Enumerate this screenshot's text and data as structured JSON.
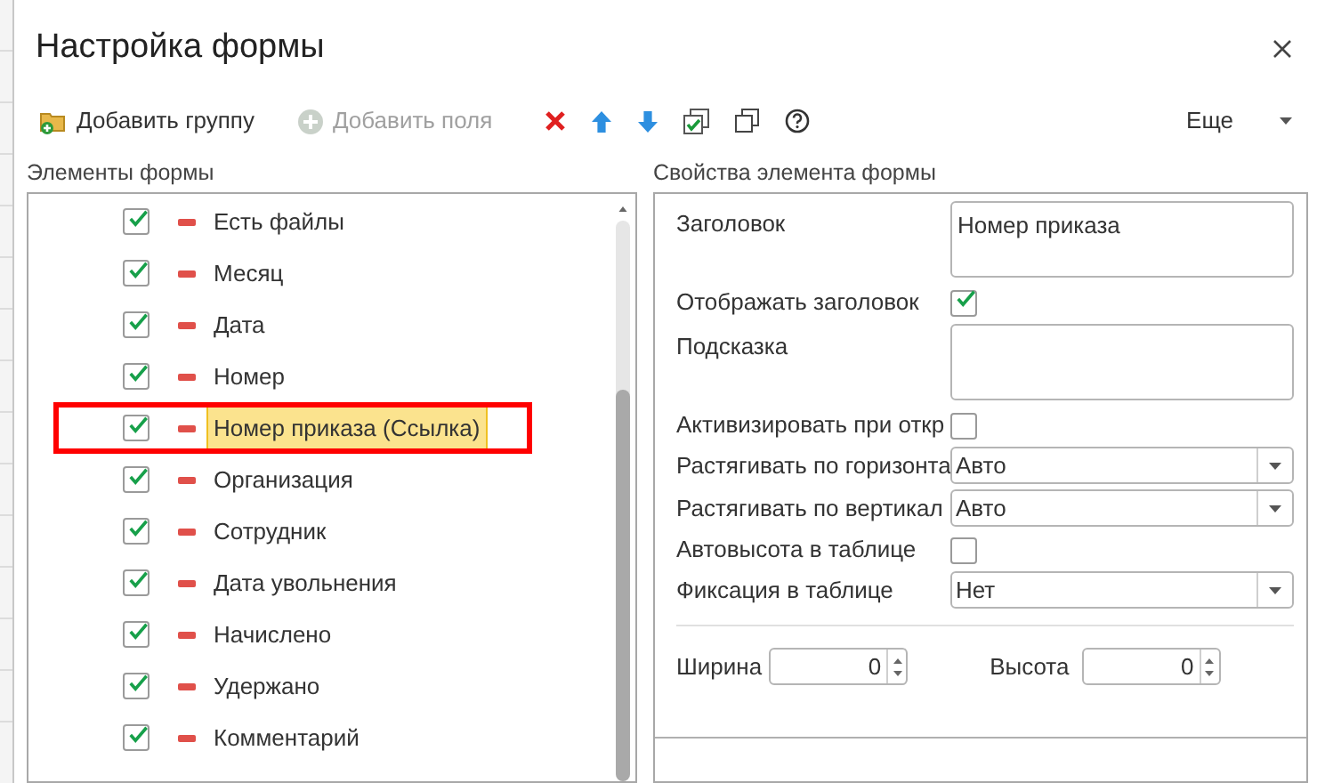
{
  "window": {
    "title": "Настройка формы"
  },
  "toolbar": [
    {
      "kind": "add-group",
      "label": "Добавить группу",
      "disabled": false
    },
    {
      "kind": "add-field",
      "label": "Добавить поля",
      "disabled": true
    },
    {
      "kind": "delete",
      "disabled": false
    },
    {
      "kind": "up",
      "disabled": false
    },
    {
      "kind": "down",
      "disabled": false
    },
    {
      "kind": "check-all",
      "disabled": false
    },
    {
      "kind": "copy",
      "disabled": false
    },
    {
      "kind": "help",
      "disabled": false
    }
  ],
  "more_button": {
    "label": "Еще"
  },
  "elements_panel": {
    "title": "Элементы формы",
    "items": [
      {
        "label": "Есть файлы",
        "checked": true,
        "selected": false,
        "highlighted": false
      },
      {
        "label": "Месяц",
        "checked": true,
        "selected": false,
        "highlighted": false
      },
      {
        "label": "Дата",
        "checked": true,
        "selected": false,
        "highlighted": false
      },
      {
        "label": "Номер",
        "checked": true,
        "selected": false,
        "highlighted": false
      },
      {
        "label": "Номер приказа (Ссылка)",
        "checked": true,
        "selected": true,
        "highlighted": true
      },
      {
        "label": "Организация",
        "checked": true,
        "selected": false,
        "highlighted": false
      },
      {
        "label": "Сотрудник",
        "checked": true,
        "selected": false,
        "highlighted": false
      },
      {
        "label": "Дата увольнения",
        "checked": true,
        "selected": false,
        "highlighted": false
      },
      {
        "label": "Начислено",
        "checked": true,
        "selected": false,
        "highlighted": false
      },
      {
        "label": "Удержано",
        "checked": true,
        "selected": false,
        "highlighted": false
      },
      {
        "label": "Комментарий",
        "checked": true,
        "selected": false,
        "highlighted": false
      }
    ]
  },
  "properties_panel": {
    "title": "Свойства элемента формы",
    "rows": [
      {
        "kind": "textarea",
        "label": "Заголовок",
        "value": "Номер приказа"
      },
      {
        "kind": "checkbox",
        "label": "Отображать заголовок",
        "checked": true
      },
      {
        "kind": "textarea",
        "label": "Подсказка"
      },
      {
        "kind": "checkbox",
        "label": "Активизировать при откр",
        "checked": false
      },
      {
        "kind": "select",
        "label": "Растягивать по горизонта",
        "value": "Авто"
      },
      {
        "kind": "select",
        "label": "Растягивать по вертикал",
        "value": "Авто"
      },
      {
        "kind": "checkbox",
        "label": "Автовысота в таблице",
        "checked": false
      },
      {
        "kind": "select",
        "label": "Фиксация в таблице",
        "value": "Нет"
      }
    ],
    "size": {
      "width_label": "Ширина",
      "width_value": "0",
      "height_label": "Высота",
      "height_value": "0"
    }
  }
}
